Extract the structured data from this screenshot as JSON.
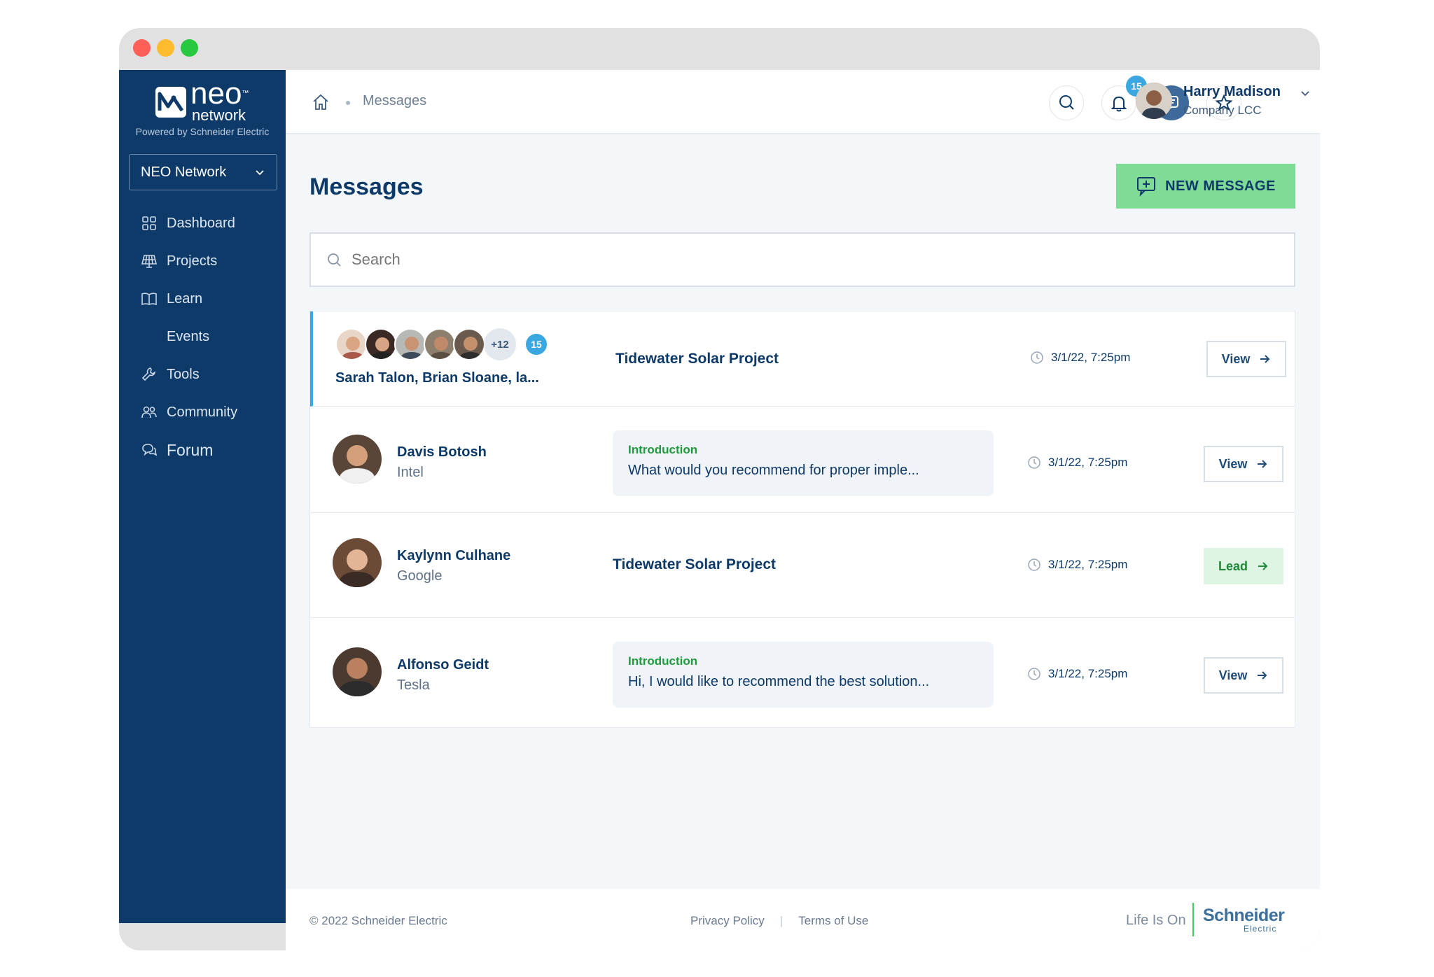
{
  "colors": {
    "sidebar": "#0d3a69",
    "accent_green": "#7fdb95",
    "badge_blue": "#3ba7e0",
    "tag_green": "#1f9a3c",
    "traffic_red": "#fe5f57",
    "traffic_yellow": "#febc2e",
    "traffic_green": "#28c840"
  },
  "sidebar": {
    "logo_word": "neo",
    "logo_tm": "™",
    "logo_sub": "network",
    "powered_by": "Powered by Schneider Electric",
    "network_select": "NEO Network",
    "items": [
      {
        "label": "Dashboard",
        "icon": "grid-icon"
      },
      {
        "label": "Projects",
        "icon": "solar-panel-icon"
      },
      {
        "label": "Learn",
        "icon": "book-icon"
      },
      {
        "label": "Events",
        "icon": ""
      },
      {
        "label": "Tools",
        "icon": "wrench-icon"
      },
      {
        "label": "Community",
        "icon": "people-icon"
      },
      {
        "label": "Forum",
        "icon": "chat-bubbles-icon"
      }
    ]
  },
  "header": {
    "breadcrumb_current": "Messages",
    "notification_count": "15",
    "user_name": "Harry Madison",
    "user_company": "Company LCC"
  },
  "main": {
    "title": "Messages",
    "new_message_label": "NEW MESSAGE",
    "search_placeholder": "Search"
  },
  "messages": [
    {
      "type": "group",
      "names": "Sarah Talon, Brian Sloane, la...",
      "more_count": "+12",
      "unread_count": "15",
      "subject": "Tidewater Solar Project",
      "time": "3/1/22, 7:25pm",
      "action": "View"
    },
    {
      "type": "person",
      "name": "Davis Botosh",
      "company": "Intel",
      "tag": "Introduction",
      "preview": "What would you recommend for proper imple...",
      "time": "3/1/22, 7:25pm",
      "action": "View"
    },
    {
      "type": "person",
      "name": "Kaylynn Culhane",
      "company": "Google",
      "subject": "Tidewater Solar Project",
      "time": "3/1/22, 7:25pm",
      "action": "Lead"
    },
    {
      "type": "person",
      "name": "Alfonso Geidt",
      "company": "Tesla",
      "tag": "Introduction",
      "preview": "Hi, I would like to recommend the best solution...",
      "time": "3/1/22, 7:25pm",
      "action": "View"
    }
  ],
  "footer": {
    "copyright": "© 2022 Schneider Electric",
    "privacy": "Privacy Policy",
    "terms": "Terms of Use",
    "separator": "|",
    "tagline": "Life Is On",
    "brand": "Schneider",
    "brand_sub": "Electric"
  }
}
